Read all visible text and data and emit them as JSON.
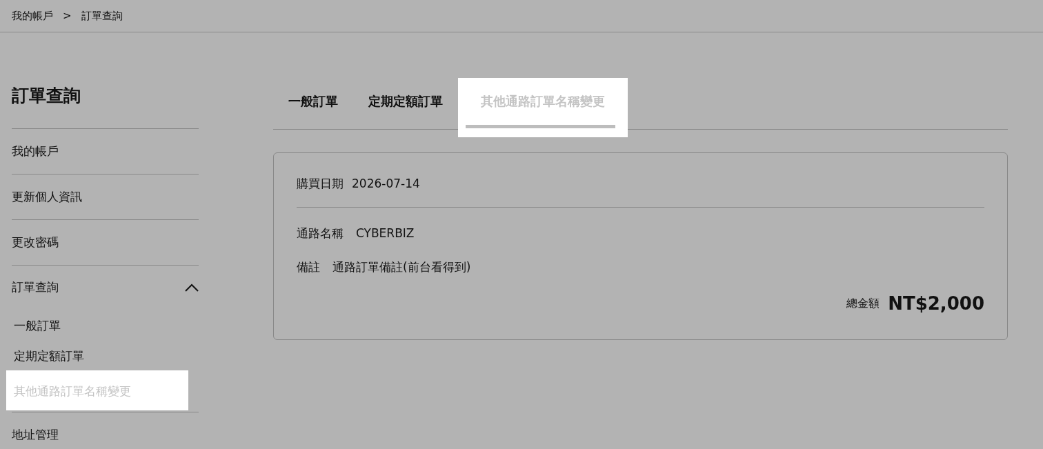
{
  "breadcrumb": {
    "items": [
      "我的帳戶",
      "訂單查詢"
    ],
    "separator": ">"
  },
  "sidebar": {
    "title": "訂單查詢",
    "items": [
      {
        "label": "我的帳戶"
      },
      {
        "label": "更新個人資訊"
      },
      {
        "label": "更改密碼"
      },
      {
        "label": "訂單查詢",
        "expanded": true,
        "children": [
          {
            "label": "一般訂單",
            "selected": false
          },
          {
            "label": "定期定額訂單",
            "selected": false
          },
          {
            "label": "其他通路訂單名稱變更",
            "selected": true
          }
        ]
      },
      {
        "label": "地址管理"
      }
    ]
  },
  "tabs": [
    {
      "label": "一般訂單",
      "selected": false
    },
    {
      "label": "定期定額訂單",
      "selected": false
    },
    {
      "label": "其他通路訂單名稱變更",
      "selected": true
    }
  ],
  "order": {
    "purchase_date": {
      "label": "購買日期",
      "value": "2026-07-14"
    },
    "fields": [
      {
        "label": "通路名稱",
        "value": "CYBERBIZ"
      },
      {
        "label": "備註",
        "value": "通路訂單備註(前台看得到)"
      }
    ],
    "total": {
      "label": "總金額",
      "value": "NT$2,000"
    }
  }
}
